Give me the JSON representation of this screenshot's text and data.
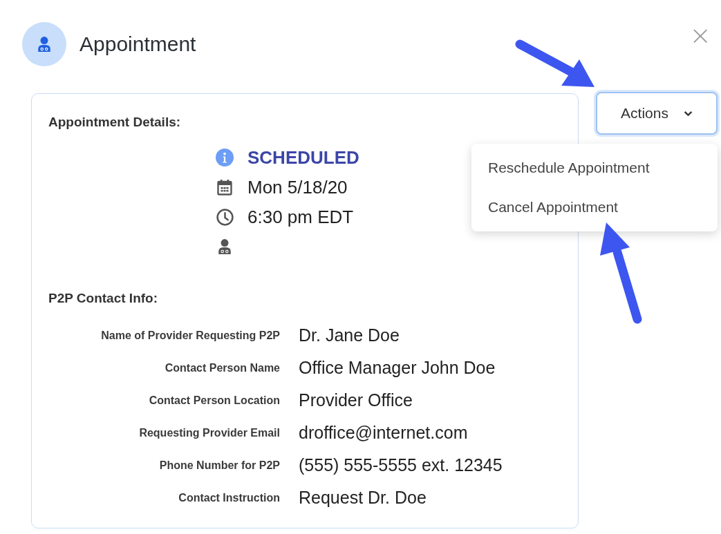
{
  "dialog": {
    "title": "Appointment",
    "close": "×"
  },
  "details": {
    "heading": "Appointment Details:",
    "items": [
      {
        "kind": "status",
        "text": "SCHEDULED"
      },
      {
        "kind": "date",
        "text": "Mon 5/18/20"
      },
      {
        "kind": "time",
        "text": "6:30 pm EDT"
      },
      {
        "kind": "provider"
      }
    ]
  },
  "contact": {
    "heading": "P2P Contact Info:",
    "rows": [
      {
        "label": "Name of Provider Requesting P2P",
        "value": "Dr. Jane Doe"
      },
      {
        "label": "Contact Person Name",
        "value": "Office Manager John Doe"
      },
      {
        "label": "Contact Person Location",
        "value": "Provider Office"
      },
      {
        "label": "Requesting Provider Email",
        "value": "droffice@internet.com"
      },
      {
        "label": "Phone Number for P2P",
        "value": "(555) 555-5555 ext. 12345"
      },
      {
        "label": "Contact Instruction",
        "value": "Request Dr. Doe"
      }
    ]
  },
  "actions": {
    "label": "Actions",
    "expanded": true,
    "menu": [
      {
        "label": "Reschedule Appointment"
      },
      {
        "label": "Cancel Appointment"
      }
    ]
  }
}
